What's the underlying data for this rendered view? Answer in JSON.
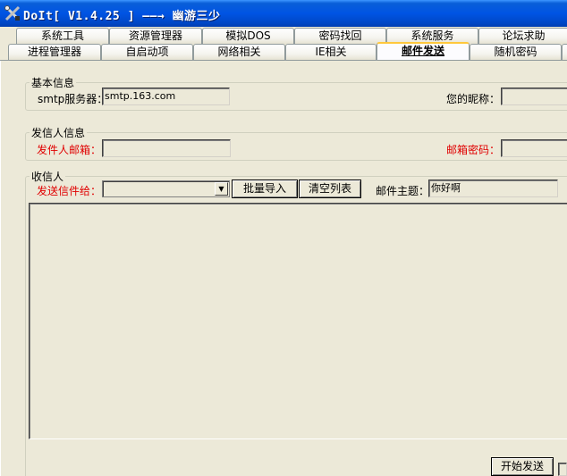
{
  "window": {
    "title": "DoIt[ V1.4.25 ] ——→ 幽游三少",
    "icon": "tools-icon"
  },
  "tabs_back": [
    "系统工具",
    "资源管理器",
    "模拟DOS",
    "密码找回",
    "系统服务",
    "论坛求助"
  ],
  "tabs_front": [
    "进程管理器",
    "自启动项",
    "网络相关",
    "IE相关",
    "邮件发送",
    "随机密码"
  ],
  "active_tab": "邮件发送",
  "basic_info": {
    "title": "基本信息",
    "smtp_label": "smtp服务器：",
    "smtp_value": "smtp.163.com",
    "nickname_label": "您的昵称：",
    "nickname_value": ""
  },
  "sender_info": {
    "title": "发信人信息",
    "email_label": "发件人邮箱：",
    "email_value": "",
    "password_label": "邮箱密码：",
    "password_value": ""
  },
  "recipient": {
    "title": "收信人",
    "send_to_label": "发送信件给：",
    "send_to_value": "",
    "batch_import_button": "批量导入",
    "clear_list_button": "清空列表",
    "subject_label": "邮件主题：",
    "subject_value": "你好啊",
    "body_value": ""
  },
  "start_send_button": "开始发送"
}
